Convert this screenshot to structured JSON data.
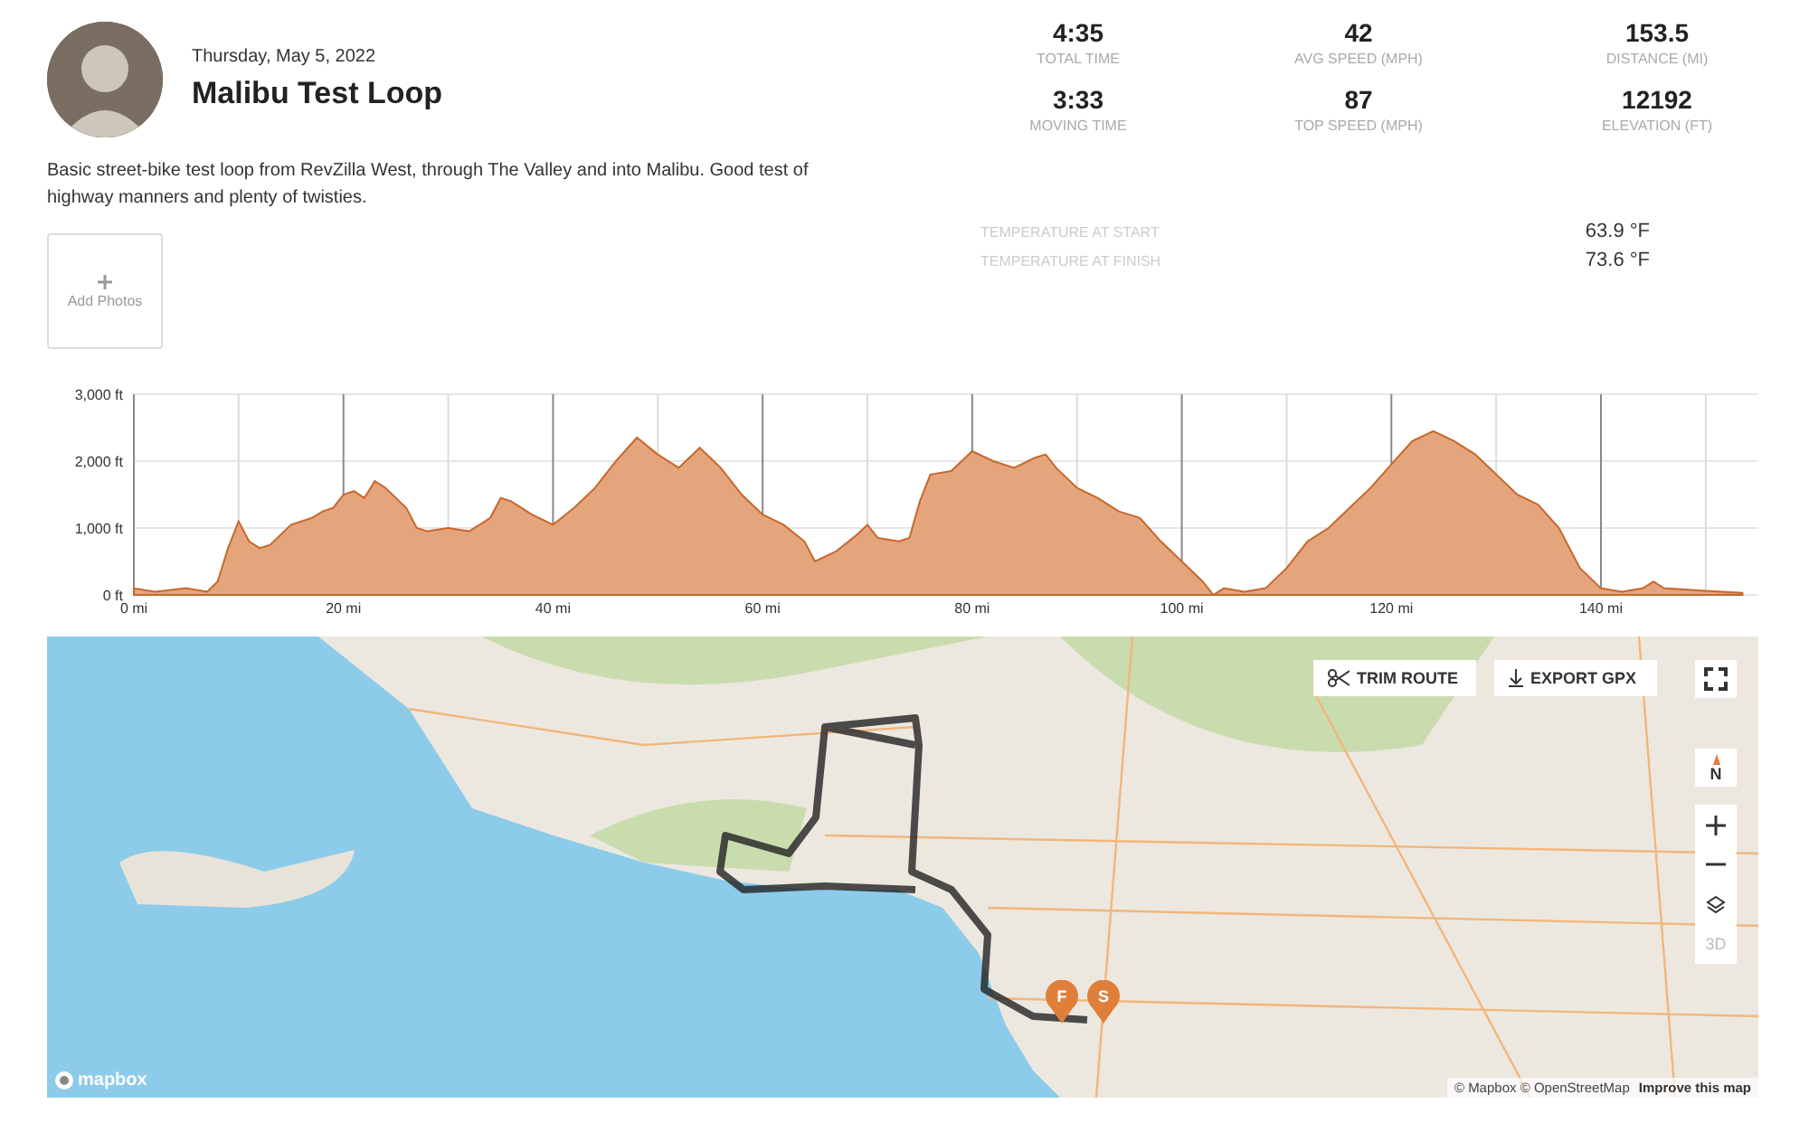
{
  "ride": {
    "date": "Thursday, May 5, 2022",
    "title": "Malibu Test Loop",
    "description": "Basic street-bike test loop from RevZilla West, through The Valley and into Malibu. Good test of highway manners and plenty of twisties.",
    "add_photos": "Add Photos"
  },
  "stats": [
    {
      "value": "4:35",
      "label": "TOTAL TIME"
    },
    {
      "value": "42",
      "label": "AVG SPEED (MPH)"
    },
    {
      "value": "153.5",
      "label": "DISTANCE (MI)"
    },
    {
      "value": "3:33",
      "label": "MOVING TIME"
    },
    {
      "value": "87",
      "label": "TOP SPEED (MPH)"
    },
    {
      "value": "12192",
      "label": "ELEVATION (FT)"
    }
  ],
  "temperatures": [
    {
      "label": "TEMPERATURE AT START",
      "value": "63.9 °F"
    },
    {
      "label": "TEMPERATURE AT FINISH",
      "value": "73.6 °F"
    }
  ],
  "elevation_profile": {
    "chart_data": {
      "type": "area",
      "grid": true,
      "xlim": [
        0,
        155
      ],
      "ylim": [
        0,
        3000
      ],
      "xticks": [
        {
          "value": 0,
          "label": "0 mi"
        },
        {
          "value": 20,
          "label": "20 mi"
        },
        {
          "value": 40,
          "label": "40 mi"
        },
        {
          "value": 60,
          "label": "60 mi"
        },
        {
          "value": 80,
          "label": "80 mi"
        },
        {
          "value": 100,
          "label": "100 mi"
        },
        {
          "value": 120,
          "label": "120 mi"
        },
        {
          "value": 140,
          "label": "140 mi"
        }
      ],
      "yticks": [
        {
          "value": 0,
          "label": "0 ft"
        },
        {
          "value": 1000,
          "label": "1,000 ft"
        },
        {
          "value": 2000,
          "label": "2,000 ft"
        },
        {
          "value": 3000,
          "label": "3,000 ft"
        }
      ],
      "x": [
        0,
        2,
        5,
        7,
        8,
        9,
        10,
        11,
        12,
        13,
        15,
        17,
        18,
        19,
        20,
        21,
        22,
        23,
        24,
        26,
        27,
        28,
        30,
        32,
        34,
        35,
        36,
        38,
        40,
        42,
        44,
        46,
        48,
        50,
        52,
        54,
        56,
        58,
        60,
        62,
        64,
        65,
        67,
        69,
        70,
        71,
        73,
        74,
        75,
        76,
        78,
        80,
        82,
        84,
        86,
        87,
        88,
        90,
        92,
        94,
        96,
        98,
        100,
        102,
        103,
        104,
        106,
        108,
        110,
        112,
        114,
        116,
        118,
        120,
        122,
        124,
        126,
        128,
        130,
        132,
        134,
        136,
        138,
        140,
        142,
        144,
        145,
        146,
        148,
        150,
        153.5
      ],
      "series": [
        {
          "color": "#e5a57c",
          "values": [
            100,
            50,
            100,
            50,
            200,
            700,
            1100,
            800,
            700,
            750,
            1050,
            1150,
            1250,
            1300,
            1500,
            1550,
            1450,
            1700,
            1600,
            1300,
            1000,
            950,
            1000,
            950,
            1150,
            1450,
            1400,
            1200,
            1050,
            1300,
            1600,
            2000,
            2350,
            2100,
            1900,
            2200,
            1900,
            1500,
            1200,
            1050,
            800,
            500,
            650,
            900,
            1050,
            850,
            800,
            850,
            1400,
            1800,
            1850,
            2150,
            2000,
            1900,
            2050,
            2100,
            1900,
            1600,
            1450,
            1250,
            1150,
            800,
            500,
            200,
            0,
            100,
            50,
            100,
            400,
            800,
            1000,
            1300,
            1600,
            1950,
            2300,
            2450,
            2300,
            2100,
            1800,
            1500,
            1350,
            1000,
            400,
            100,
            50,
            100,
            200,
            100,
            80,
            60,
            30
          ]
        }
      ]
    }
  },
  "map": {
    "trim_button": "TRIM ROUTE",
    "export_button": "EXPORT GPX",
    "compass": "N",
    "three_d": {
      "label": "3D",
      "disabled": true
    },
    "markers": [
      {
        "label": "F"
      },
      {
        "label": "S"
      }
    ],
    "logo": "mapbox",
    "attribution": "© Mapbox © OpenStreetMap",
    "improve_link": "Improve this map"
  }
}
